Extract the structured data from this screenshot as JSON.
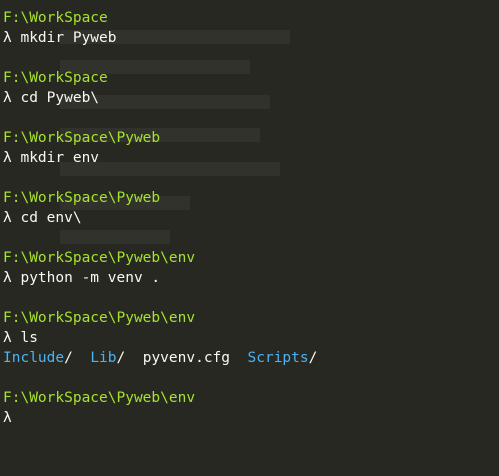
{
  "prompt_symbol": "λ",
  "entries": [
    {
      "path": "F:\\WorkSpace",
      "command": "mkdir Pyweb"
    },
    {
      "path": "F:\\WorkSpace",
      "command": "cd Pyweb\\"
    },
    {
      "path": "F:\\WorkSpace\\Pyweb",
      "command": "mkdir env"
    },
    {
      "path": "F:\\WorkSpace\\Pyweb",
      "command": "cd env\\"
    },
    {
      "path": "F:\\WorkSpace\\Pyweb\\env",
      "command": "python -m venv ."
    },
    {
      "path": "F:\\WorkSpace\\Pyweb\\env",
      "command": "ls"
    }
  ],
  "ls_output": {
    "dir1": "Include",
    "dir2": "Lib",
    "file1": "pyvenv.cfg",
    "dir3": "Scripts",
    "slash": "/"
  },
  "final_path": "F:\\WorkSpace\\Pyweb\\env",
  "colors": {
    "background": "#272822",
    "path": "#a6e22e",
    "text": "#f8f8f2",
    "directory": "#4eb3f0"
  }
}
